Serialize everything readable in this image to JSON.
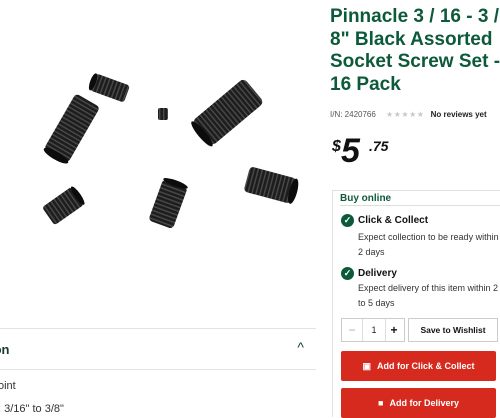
{
  "product": {
    "title": "Pinnacle 3 / 16 - 3 / 8\" Black Assorted Socket Screw Set - 16 Pack",
    "item_number": "I/N: 2420766",
    "rating_stars": "★★★★★",
    "reviews": "No reviews yet",
    "price": {
      "currency": "$",
      "dollars": "5",
      "cents": ".75"
    }
  },
  "buy": {
    "title": "Buy online",
    "options": [
      {
        "title": "Click & Collect",
        "text": "Expect collection to be ready within 2 days",
        "icon": "check-icon"
      },
      {
        "title": "Delivery",
        "text": "Expect delivery of this item within 2 to 5 days",
        "icon": "check-icon"
      }
    ],
    "quantity": "1",
    "minus": "−",
    "plus": "+",
    "wishlist": "Save to Wishlist",
    "click_collect_button": "Add for Click & Collect",
    "delivery_button": "Add for Delivery"
  },
  "description": {
    "header": "ion",
    "chevron": "^",
    "lines": [
      "oint",
      ": 3/16\" to 3/8\""
    ]
  },
  "colors": {
    "brand_green": "#0d5a3a",
    "action_red": "#d62a1e"
  }
}
